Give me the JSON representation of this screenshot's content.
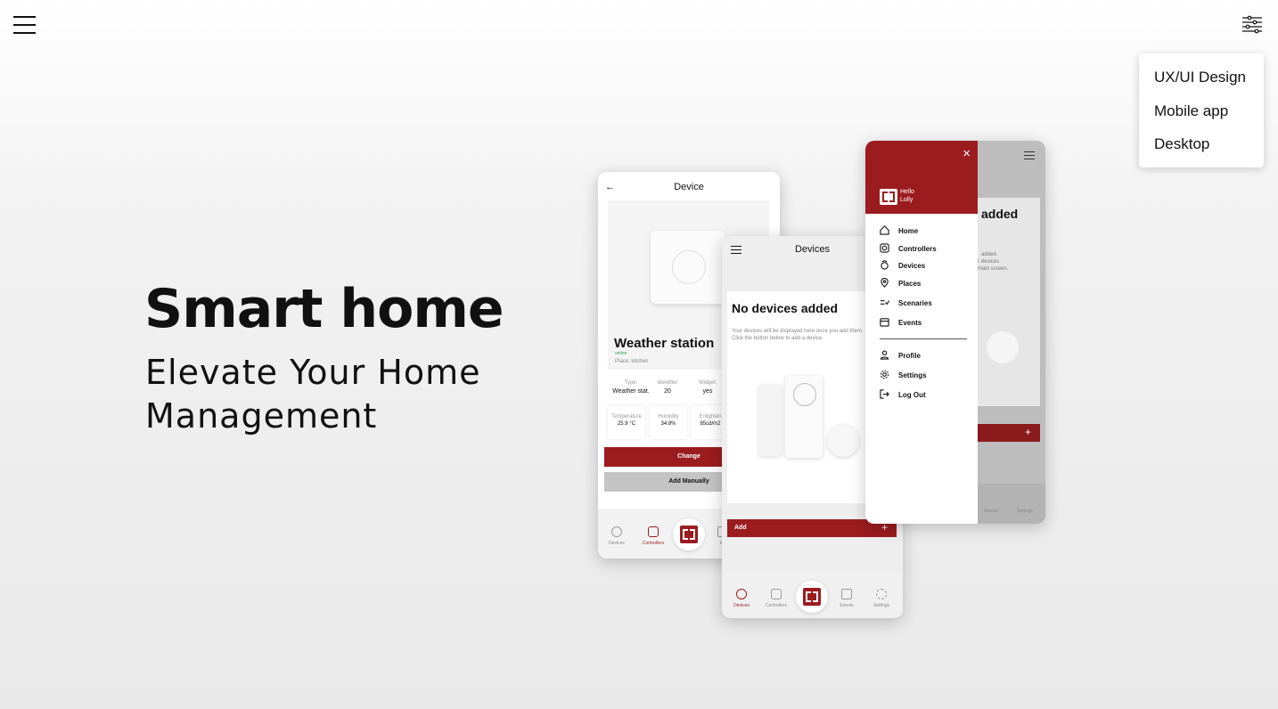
{
  "header": {
    "menu_icon": "hamburger-icon",
    "filter_icon": "sliders-icon"
  },
  "filter_menu": {
    "items": [
      "UX/UI Design",
      "Mobile app",
      "Desktop"
    ]
  },
  "hero": {
    "title": "Smart home",
    "subtitle_line1": "Elevate Your Home",
    "subtitle_line2": "Management"
  },
  "phone_device": {
    "title": "Device",
    "device_name": "Weather station",
    "status": "online",
    "place": "Place: kitchen",
    "info": [
      {
        "label": "Type:",
        "value": "Weather stat."
      },
      {
        "label": "Identifier",
        "value": "20"
      },
      {
        "label": "Widget:",
        "value": "yes"
      }
    ],
    "stats": [
      {
        "label": "Temperature",
        "value": "25.9 °C"
      },
      {
        "label": "Humidity",
        "value": "34.8%"
      },
      {
        "label": "Enlighten",
        "value": "85cd/m2"
      }
    ],
    "change_label": "Change",
    "add_manually_label": "Add Manually",
    "nav": [
      "Devices",
      "Controllers",
      "Ev"
    ]
  },
  "phone_devices": {
    "title": "Devices",
    "empty_title": "No devices added",
    "empty_text": "Your devices will be displayed here once you add them. Click the button below to add a device.",
    "add_label": "Add",
    "add_plus": "+",
    "nav": [
      "Devices",
      "Controllers",
      "Events",
      "Settings"
    ]
  },
  "phone_menu": {
    "close": "×",
    "greeting_line1": "Hello",
    "greeting_line2": "Lolly",
    "items": [
      "Home",
      "Controllers",
      "Devices",
      "Places",
      "Scenaries",
      "Events"
    ],
    "items2": [
      "Profile",
      "Settings",
      "Log Out"
    ],
    "bg_title": "added",
    "bg_text": [
      "added.",
      "r devices",
      "main screen."
    ],
    "bg_plus": "+",
    "bg_nav": [
      "Events",
      "Settings"
    ]
  },
  "colors": {
    "brand_red": "#9b1c1f",
    "online_green": "#2fa84f"
  }
}
